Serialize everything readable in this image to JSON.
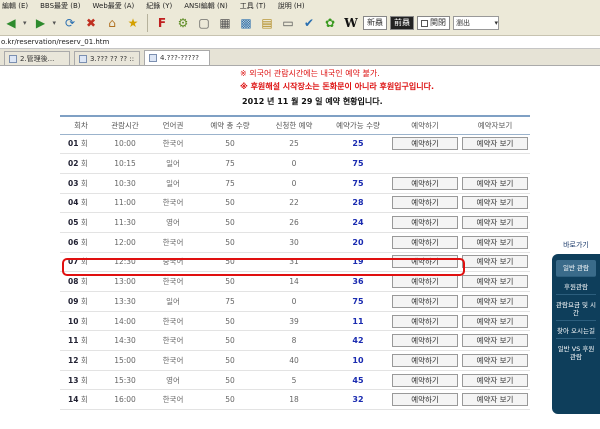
{
  "menu": [
    "編輯 (E)",
    "BBS最愛 (B)",
    "Web最愛 (A)",
    "紀錄 (Y)",
    "ANSI編輯 (N)",
    "工具 (T)",
    "說明 (H)"
  ],
  "toolbar": {
    "new_label": "新贔",
    "prev_label": "前贔",
    "check_label": "関閉",
    "select_label": "瀏出"
  },
  "address": {
    "url": "o.kr/reservation/reserv_01.htm"
  },
  "tabs": [
    {
      "label": "2.管理後..."
    },
    {
      "label": "3.??? ?? ?? ::"
    },
    {
      "label": "4.???-?????"
    }
  ],
  "notices": {
    "line1": "※ 외국어 관람시간에는 내국인 예약 불가.",
    "line2": "※ 후원해설 시작장소는 돈화문이 아니라 후원입구입니다.",
    "heading": "2012 년 11 월 29 일 예약 현황입니다."
  },
  "table": {
    "headers": [
      "회차",
      "관람시간",
      "언어권",
      "예약 총 수량",
      "신청한 예약",
      "예약가능 수량",
      "예약하기",
      "예약자보기"
    ],
    "reserve_label": "예약하기",
    "view_label": "예약자 보기",
    "rows": [
      {
        "num": "01",
        "unit": "회",
        "time": "10:00",
        "lang": "한국어",
        "total": "50",
        "booked": "25",
        "avail": "25",
        "reserve": true,
        "view": true
      },
      {
        "num": "02",
        "unit": "회",
        "time": "10:15",
        "lang": "일어",
        "total": "75",
        "booked": "0",
        "avail": "75",
        "reserve": false,
        "view": false
      },
      {
        "num": "03",
        "unit": "회",
        "time": "10:30",
        "lang": "일어",
        "total": "75",
        "booked": "0",
        "avail": "75",
        "reserve": true,
        "view": true
      },
      {
        "num": "04",
        "unit": "회",
        "time": "11:00",
        "lang": "한국어",
        "total": "50",
        "booked": "22",
        "avail": "28",
        "reserve": true,
        "view": true
      },
      {
        "num": "05",
        "unit": "회",
        "time": "11:30",
        "lang": "영어",
        "total": "50",
        "booked": "26",
        "avail": "24",
        "reserve": true,
        "view": true
      },
      {
        "num": "06",
        "unit": "회",
        "time": "12:00",
        "lang": "한국어",
        "total": "50",
        "booked": "30",
        "avail": "20",
        "reserve": true,
        "view": true
      },
      {
        "num": "07",
        "unit": "회",
        "time": "12:30",
        "lang": "중국어",
        "total": "50",
        "booked": "31",
        "avail": "19",
        "reserve": true,
        "view": true
      },
      {
        "num": "08",
        "unit": "회",
        "time": "13:00",
        "lang": "한국어",
        "total": "50",
        "booked": "14",
        "avail": "36",
        "reserve": true,
        "view": true
      },
      {
        "num": "09",
        "unit": "회",
        "time": "13:30",
        "lang": "일어",
        "total": "75",
        "booked": "0",
        "avail": "75",
        "reserve": true,
        "view": true
      },
      {
        "num": "10",
        "unit": "회",
        "time": "14:00",
        "lang": "한국어",
        "total": "50",
        "booked": "39",
        "avail": "11",
        "reserve": true,
        "view": true
      },
      {
        "num": "11",
        "unit": "회",
        "time": "14:30",
        "lang": "한국어",
        "total": "50",
        "booked": "8",
        "avail": "42",
        "reserve": true,
        "view": true
      },
      {
        "num": "12",
        "unit": "회",
        "time": "15:00",
        "lang": "한국어",
        "total": "50",
        "booked": "40",
        "avail": "10",
        "reserve": true,
        "view": true
      },
      {
        "num": "13",
        "unit": "회",
        "time": "15:30",
        "lang": "영어",
        "total": "50",
        "booked": "5",
        "avail": "45",
        "reserve": true,
        "view": true
      },
      {
        "num": "14",
        "unit": "회",
        "time": "16:00",
        "lang": "한국어",
        "total": "50",
        "booked": "18",
        "avail": "32",
        "reserve": true,
        "view": true
      }
    ]
  },
  "quick_menu": {
    "title": "바로가기",
    "items": [
      "일반 관람",
      "후원관람",
      "관람요금 및 시간",
      "찾아 오시는길",
      "일반 VS 후원 관람"
    ]
  },
  "colors": {
    "accent_blue": "#1a2bb0",
    "notice_red": "#d11111",
    "highlight_red": "#e01010",
    "quick_panel": "#0e3e5b"
  }
}
